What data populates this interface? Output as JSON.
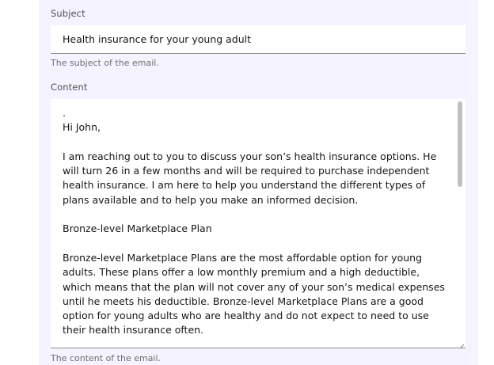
{
  "subject": {
    "label": "Subject",
    "value": "Health insurance for your young adult",
    "helper": "The subject of the email."
  },
  "content": {
    "label": "Content",
    "value": ".\nHi John,\n\nI am reaching out to you to discuss your son’s health insurance options. He will turn 26 in a few months and will be required to purchase independent health insurance. I am here to help you understand the different types of plans available and to help you make an informed decision.\n\nBronze-level Marketplace Plan\n\nBronze-level Marketplace Plans are the most affordable option for young adults. These plans offer a low monthly premium and a high deductible, which means that the plan will not cover any of your son’s medical expenses until he meets his deductible. Bronze-level Marketplace Plans are a good option for young adults who are healthy and do not expect to need to use their health insurance often.",
    "helper": "The content of the email."
  },
  "colors": {
    "panel_background": "#f4f3ff",
    "field_background": "#ffffff",
    "text": "#161616",
    "label": "#525252"
  }
}
